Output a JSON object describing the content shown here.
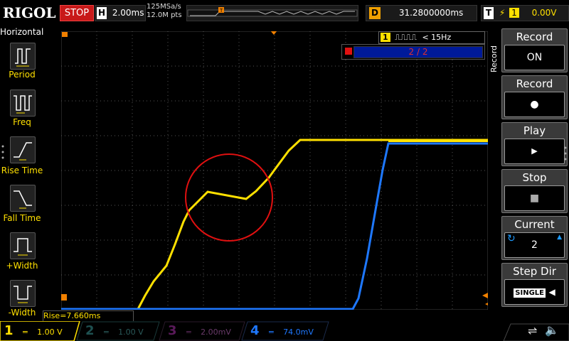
{
  "top": {
    "logo": "RIGOL",
    "run_state": "STOP",
    "timebase_label": "H",
    "timebase": "2.00ms",
    "sample_rate": "125MSa/s",
    "memory_depth": "12.0M pts",
    "delay_label": "D",
    "delay": "31.2800000ms",
    "trigger_label": "T",
    "trigger_channel": "1",
    "trigger_level": "0.00V"
  },
  "left_panel": {
    "title": "Horizontal",
    "items": [
      {
        "label": "Period",
        "icon": "period-icon"
      },
      {
        "label": "Freq",
        "icon": "freq-icon"
      },
      {
        "label": "Rise Time",
        "icon": "rise-time-icon"
      },
      {
        "label": "Fall Time",
        "icon": "fall-time-icon"
      },
      {
        "label": "+Width",
        "icon": "positive-width-icon"
      },
      {
        "label": "-Width",
        "icon": "negative-width-icon"
      }
    ]
  },
  "right_panel": {
    "vertical_label": "Record",
    "items": [
      {
        "title": "Record",
        "value": "ON"
      },
      {
        "title": "Record",
        "value": "●"
      },
      {
        "title": "Play",
        "value": "▶"
      },
      {
        "title": "Stop",
        "value": "■"
      },
      {
        "title": "Current",
        "value": "2"
      },
      {
        "title": "Step Dir",
        "value": "SINGLE"
      }
    ]
  },
  "trigger_filter": {
    "channel": "1",
    "text": "< 15Hz"
  },
  "frame": {
    "text": "2 / 2"
  },
  "measurement": "Rise=7.660ms",
  "channels": [
    {
      "num": "1",
      "scale": "1.00 V",
      "color": "#ffe000",
      "active": true
    },
    {
      "num": "2",
      "scale": "1.00 V",
      "color": "#00a0a0",
      "active": false
    },
    {
      "num": "3",
      "scale": "2.00mV",
      "color": "#c000c0",
      "active": false
    },
    {
      "num": "4",
      "scale": "74.0mV",
      "color": "#1e78ff",
      "active": false
    }
  ],
  "colors": {
    "ch1": "#ffe000",
    "ch4": "#1e78ff",
    "accent": "#f08000",
    "stop": "#c81919",
    "highlight_circle": "#e01010"
  }
}
